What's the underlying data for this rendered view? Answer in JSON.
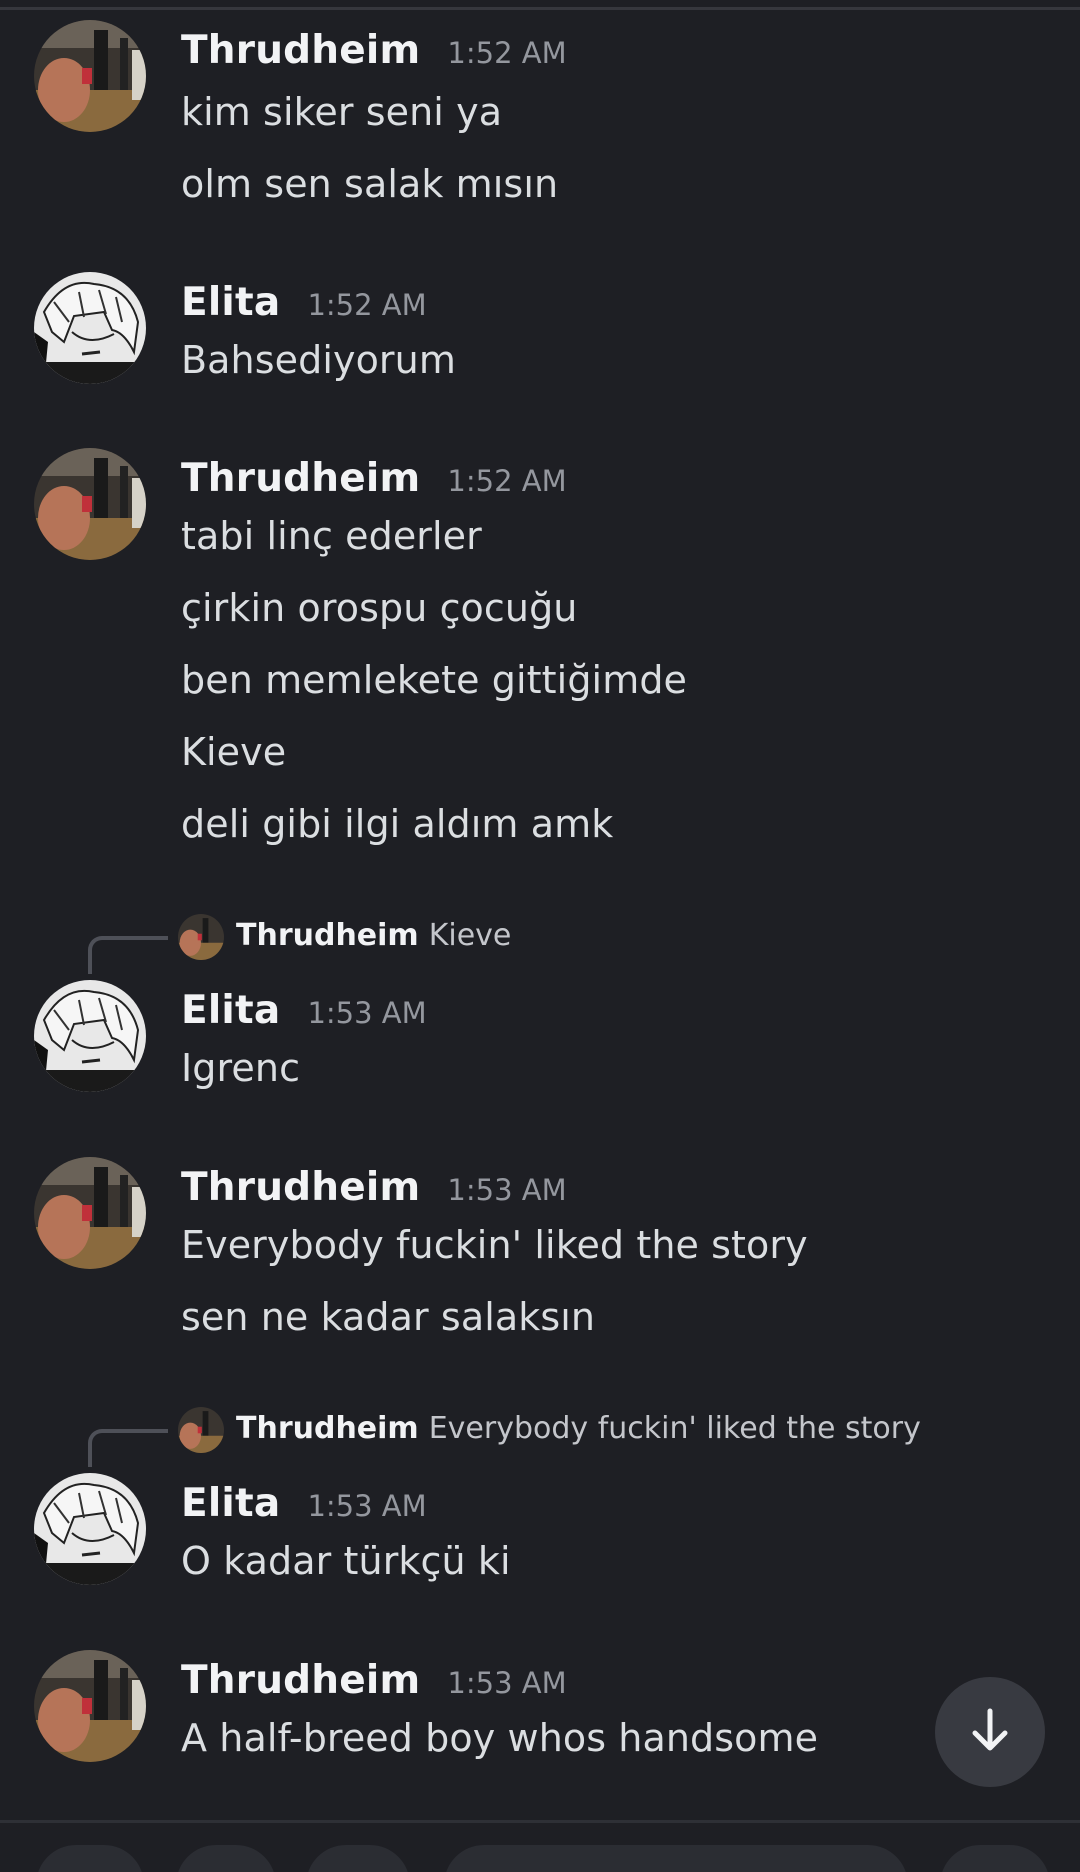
{
  "messages": [
    {
      "user": "Thrudheim",
      "time": "1:52 AM",
      "avatar": "gym-photo-avatar",
      "lines": [
        "kim siker seni ya",
        "olm sen salak mısın"
      ]
    },
    {
      "user": "Elita",
      "time": "1:52 AM",
      "avatar": "manga-portrait-avatar",
      "lines": [
        "Bahsediyorum"
      ]
    },
    {
      "user": "Thrudheim",
      "time": "1:52 AM",
      "avatar": "gym-photo-avatar",
      "lines": [
        "tabi linç ederler",
        "çirkin orospu çocuğu",
        "ben memlekete gittiğimde",
        "Kieve",
        "deli gibi ilgi aldım amk"
      ]
    },
    {
      "user": "Elita",
      "time": "1:53 AM",
      "avatar": "manga-portrait-avatar",
      "reply": {
        "user": "Thrudheim",
        "snippet": "Kieve"
      },
      "lines": [
        "Igrenc"
      ]
    },
    {
      "user": "Thrudheim",
      "time": "1:53 AM",
      "avatar": "gym-photo-avatar",
      "lines": [
        "Everybody fuckin' liked the story",
        "sen ne kadar salaksın"
      ]
    },
    {
      "user": "Elita",
      "time": "1:53 AM",
      "avatar": "manga-portrait-avatar",
      "reply": {
        "user": "Thrudheim",
        "snippet": "Everybody fuckin' liked the story"
      },
      "lines": [
        "O kadar türkçü ki"
      ]
    },
    {
      "user": "Thrudheim",
      "time": "1:53 AM",
      "avatar": "gym-photo-avatar",
      "lines": [
        "A half-breed boy whos handsome"
      ]
    }
  ],
  "scroll_button": {
    "icon": "arrow-down-icon"
  },
  "colors": {
    "background": "#1e1f24",
    "username": "#f2f3f5",
    "timestamp": "#94979e",
    "text": "#dbdee1",
    "scroll_button": "#383a41"
  }
}
